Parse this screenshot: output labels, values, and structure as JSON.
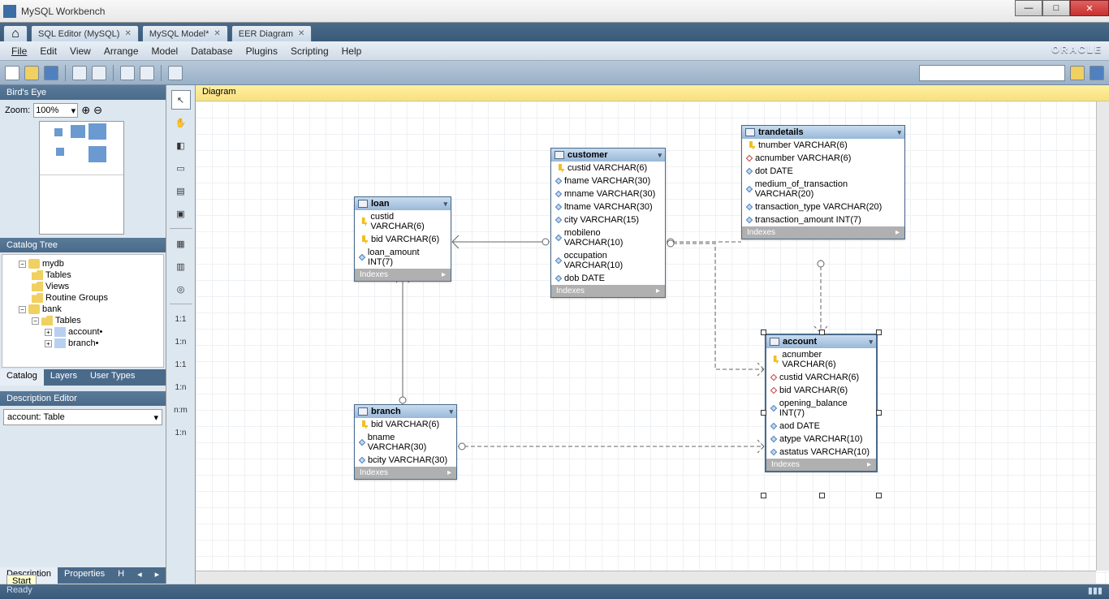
{
  "app": {
    "title": "MySQL Workbench"
  },
  "win_buttons": {
    "min": "—",
    "max": "□",
    "close": "✕"
  },
  "tabs": {
    "sql_editor": "SQL Editor (MySQL)",
    "mysql_model": "MySQL Model*",
    "eer_diagram": "EER Diagram"
  },
  "menu": {
    "file": "File",
    "edit": "Edit",
    "view": "View",
    "arrange": "Arrange",
    "model": "Model",
    "database": "Database",
    "plugins": "Plugins",
    "scripting": "Scripting",
    "help": "Help",
    "brand": "ORACLE"
  },
  "sidebar": {
    "birds_eye": "Bird's Eye",
    "zoom_label": "Zoom:",
    "zoom_value": "100%",
    "catalog_tree": "Catalog Tree",
    "tree": {
      "mydb": "mydb",
      "tables": "Tables",
      "views": "Views",
      "routine_groups": "Routine Groups",
      "bank": "bank",
      "account": "account",
      "branch": "branch"
    },
    "tabs": {
      "catalog": "Catalog",
      "layers": "Layers",
      "user_types": "User Types"
    },
    "description_editor": "Description Editor",
    "desc_value": "account: Table",
    "bottom": {
      "description": "Description",
      "properties": "Properties",
      "h": "H"
    }
  },
  "vtools": {
    "one_one": "1:1",
    "one_n": "1:n",
    "one_one_b": "1:1",
    "one_n_b": "1:n",
    "n_m": "n:m",
    "one_n_c": "1:n"
  },
  "canvas": {
    "tab": "Diagram"
  },
  "ent": {
    "loan": {
      "name": "loan",
      "cols": [
        {
          "k": "pk",
          "t": "custid VARCHAR(6)"
        },
        {
          "k": "pk",
          "t": "bid VARCHAR(6)"
        },
        {
          "k": "col",
          "t": "loan_amount INT(7)"
        }
      ],
      "idx": "Indexes"
    },
    "customer": {
      "name": "customer",
      "cols": [
        {
          "k": "pk",
          "t": "custid VARCHAR(6)"
        },
        {
          "k": "col",
          "t": "fname VARCHAR(30)"
        },
        {
          "k": "col",
          "t": "mname VARCHAR(30)"
        },
        {
          "k": "col",
          "t": "ltname VARCHAR(30)"
        },
        {
          "k": "col",
          "t": "city VARCHAR(15)"
        },
        {
          "k": "col",
          "t": "mobileno VARCHAR(10)"
        },
        {
          "k": "col",
          "t": "occupation VARCHAR(10)"
        },
        {
          "k": "col",
          "t": "dob DATE"
        }
      ],
      "idx": "Indexes"
    },
    "trandetails": {
      "name": "trandetails",
      "cols": [
        {
          "k": "pk",
          "t": "tnumber VARCHAR(6)"
        },
        {
          "k": "fk",
          "t": "acnumber VARCHAR(6)"
        },
        {
          "k": "col",
          "t": "dot DATE"
        },
        {
          "k": "col",
          "t": "medium_of_transaction VARCHAR(20)"
        },
        {
          "k": "col",
          "t": "transaction_type VARCHAR(20)"
        },
        {
          "k": "col",
          "t": "transaction_amount INT(7)"
        }
      ],
      "idx": "Indexes"
    },
    "branch": {
      "name": "branch",
      "cols": [
        {
          "k": "pk",
          "t": "bid VARCHAR(6)"
        },
        {
          "k": "col",
          "t": "bname VARCHAR(30)"
        },
        {
          "k": "col",
          "t": "bcity VARCHAR(30)"
        }
      ],
      "idx": "Indexes"
    },
    "account": {
      "name": "account",
      "cols": [
        {
          "k": "pk",
          "t": "acnumber VARCHAR(6)"
        },
        {
          "k": "fk",
          "t": "custid VARCHAR(6)"
        },
        {
          "k": "fk",
          "t": "bid VARCHAR(6)"
        },
        {
          "k": "col",
          "t": "opening_balance INT(7)"
        },
        {
          "k": "col",
          "t": "aod DATE"
        },
        {
          "k": "col",
          "t": "atype VARCHAR(10)"
        },
        {
          "k": "col",
          "t": "astatus VARCHAR(10)"
        }
      ],
      "idx": "Indexes"
    }
  },
  "status": {
    "ready": "Ready",
    "start": "Start"
  }
}
